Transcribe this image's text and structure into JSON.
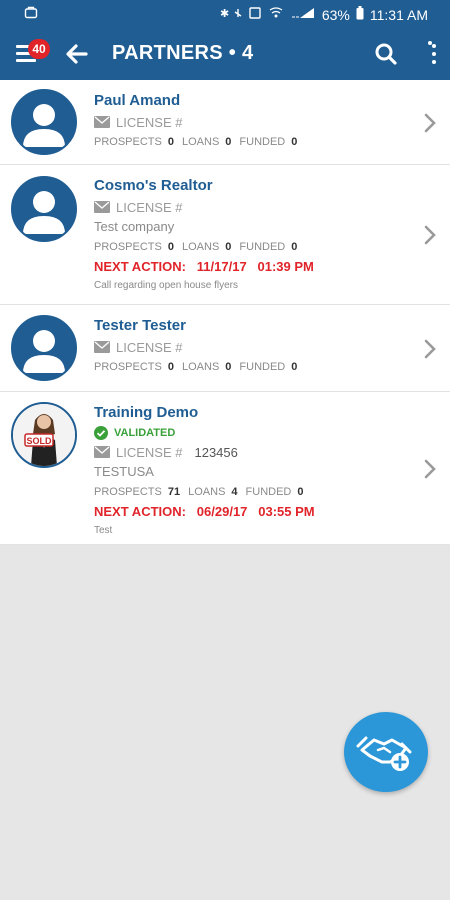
{
  "status_bar": {
    "battery": "63%",
    "time": "11:31 AM"
  },
  "app_bar": {
    "badge": "40",
    "title": "PARTNERS • 4"
  },
  "stat_labels": {
    "prospects": "PROSPECTS",
    "loans": "LOANS",
    "funded": "FUNDED"
  },
  "partners": [
    {
      "name": "Paul Amand",
      "license_label": "LICENSE #",
      "license_value": "",
      "prospects": "0",
      "loans": "0",
      "funded": "0"
    },
    {
      "name": "Cosmo's Realtor",
      "license_label": "LICENSE #",
      "license_value": "",
      "company": "Test company",
      "prospects": "0",
      "loans": "0",
      "funded": "0",
      "next_action": "NEXT ACTION:   11/17/17   01:39 PM",
      "note": "Call regarding open house flyers"
    },
    {
      "name": "Tester Tester",
      "license_label": "LICENSE #",
      "license_value": "",
      "prospects": "0",
      "loans": "0",
      "funded": "0"
    },
    {
      "name": "Training Demo",
      "validated": "VALIDATED",
      "license_label": "LICENSE #",
      "license_value": "123456",
      "company": "TESTUSA",
      "prospects": "71",
      "loans": "4",
      "funded": "0",
      "next_action": "NEXT ACTION:   06/29/17   03:55 PM",
      "note": "Test",
      "photo_sign": "SOLD"
    }
  ],
  "colors": {
    "primary": "#1f5d93",
    "accent": "#2b97d8",
    "alert": "#e0242a",
    "success": "#3aa03a"
  },
  "icons": [
    "menu-icon",
    "back-arrow-icon",
    "search-icon",
    "more-vert-icon",
    "mail-icon",
    "chevron-right-icon",
    "check-circle-icon",
    "handshake-add-icon"
  ]
}
